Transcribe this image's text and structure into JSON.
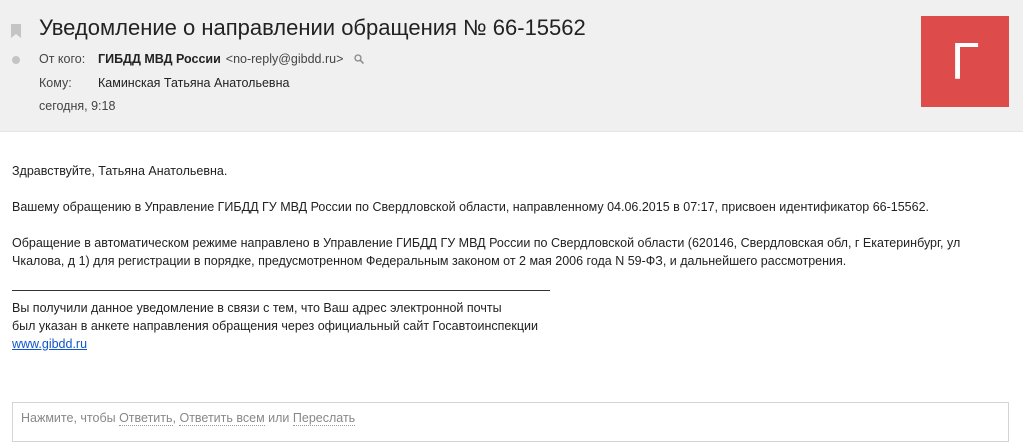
{
  "email": {
    "subject": "Уведомление о направлении обращения № 66-15562",
    "from_label": "От кого:",
    "sender_name": "ГИБДД МВД России",
    "sender_email": "<no-reply@gibdd.ru>",
    "to_label": "Кому:",
    "recipient": "Каминская Татьяна Анатольевна",
    "date": "сегодня, 9:18",
    "avatar_letter": "Г"
  },
  "body": {
    "greeting": "Здравствуйте, Татьяна Анатольевна.",
    "paragraph1": "Вашему обращению в Управление ГИБДД ГУ МВД России по Свердловской области, направленному 04.06.2015 в 07:17, присвоен идентификатор 66-15562.",
    "paragraph2": "Обращение в автоматическом режиме направлено в Управление ГИБДД ГУ МВД России по Свердловской области (620146, Свердловская обл, г Екатеринбург, ул Чкалова, д 1) для регистрации в порядке, предусмотренном Федеральным законом от 2 мая 2006 года N 59-ФЗ, и дальнейшего рассмотрения.",
    "footer_line1": "Вы получили данное уведомление в связи с тем, что Ваш адрес электронной почты",
    "footer_line2": "был указан в анкете направления обращения через официальный сайт Госавтоинспекции",
    "footer_link": "www.gibdd.ru"
  },
  "reply": {
    "prefix": "Нажмите, чтобы ",
    "reply_label": "Ответить",
    "sep1": ", ",
    "reply_all_label": "Ответить всем",
    "sep2": " или ",
    "forward_label": "Переслать"
  },
  "colors": {
    "header_bg": "#f0f0f0",
    "avatar_bg": "#dd4b4b",
    "link": "#1155cc"
  },
  "icons": {
    "bookmark": "bookmark-icon",
    "status": "status-dot-icon",
    "magnify": "magnify-icon"
  }
}
